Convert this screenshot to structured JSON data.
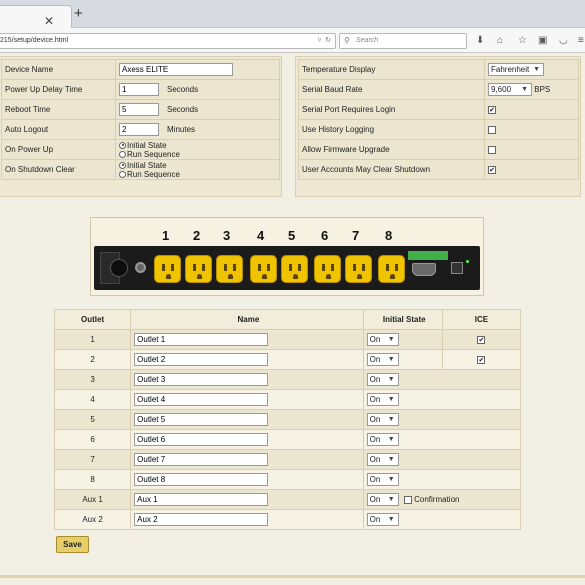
{
  "browser": {
    "url": "215/setup/device.html",
    "search_placeholder": "Search"
  },
  "left_panel": {
    "device_name": {
      "label": "Device Name",
      "value": "Axess ELITE"
    },
    "power_up_delay": {
      "label": "Power Up Delay Time",
      "value": "1",
      "unit": "Seconds"
    },
    "reboot_time": {
      "label": "Reboot Time",
      "value": "5",
      "unit": "Seconds"
    },
    "auto_logout": {
      "label": "Auto Logout",
      "value": "2",
      "unit": "Minutes"
    },
    "on_power_up": {
      "label": "On Power Up",
      "option1": "Initial State",
      "option2": "Run Sequence",
      "selected": "Initial State"
    },
    "on_shutdown_clear": {
      "label": "On Shutdown Clear",
      "option1": "Initial State",
      "option2": "Run Sequence",
      "selected": "Initial State"
    }
  },
  "right_panel": {
    "temperature_display": {
      "label": "Temperature Display",
      "value": "Fahrenheit"
    },
    "serial_baud_rate": {
      "label": "Serial Baud Rate",
      "value": "9,600",
      "unit": "BPS"
    },
    "serial_port_login": {
      "label": "Serial Port Requires Login",
      "checked": true
    },
    "history_logging": {
      "label": "Use History Logging",
      "checked": false
    },
    "firmware_upgrade": {
      "label": "Allow Firmware Upgrade",
      "checked": false
    },
    "clear_shutdown": {
      "label": "User Accounts May Clear Shutdown",
      "checked": true
    }
  },
  "device_numbers": [
    "1",
    "2",
    "3",
    "4",
    "5",
    "6",
    "7",
    "8"
  ],
  "outlet_table": {
    "headers": {
      "outlet": "Outlet",
      "name": "Name",
      "initial_state": "Initial State",
      "ice": "ICE"
    },
    "rows": [
      {
        "outlet": "1",
        "name": "Outlet 1",
        "state": "On",
        "ice": true
      },
      {
        "outlet": "2",
        "name": "Outlet 2",
        "state": "On",
        "ice": true
      },
      {
        "outlet": "3",
        "name": "Outlet 3",
        "state": "On"
      },
      {
        "outlet": "4",
        "name": "Outlet 4",
        "state": "On"
      },
      {
        "outlet": "5",
        "name": "Outlet 5",
        "state": "On"
      },
      {
        "outlet": "6",
        "name": "Outlet 6",
        "state": "On"
      },
      {
        "outlet": "7",
        "name": "Outlet 7",
        "state": "On"
      },
      {
        "outlet": "8",
        "name": "Outlet 8",
        "state": "On"
      },
      {
        "outlet": "Aux 1",
        "name": "Aux 1",
        "state": "On",
        "confirmation_label": "Confirmation",
        "confirmation_checked": false
      },
      {
        "outlet": "Aux 2",
        "name": "Aux 2",
        "state": "On"
      }
    ]
  },
  "save_label": "Save",
  "colors": {
    "page_bg": "#f2efe4",
    "panel_bg": "#ece6d0",
    "outlet_yellow": "#f0c300",
    "save_button": "#e6ce6a"
  }
}
